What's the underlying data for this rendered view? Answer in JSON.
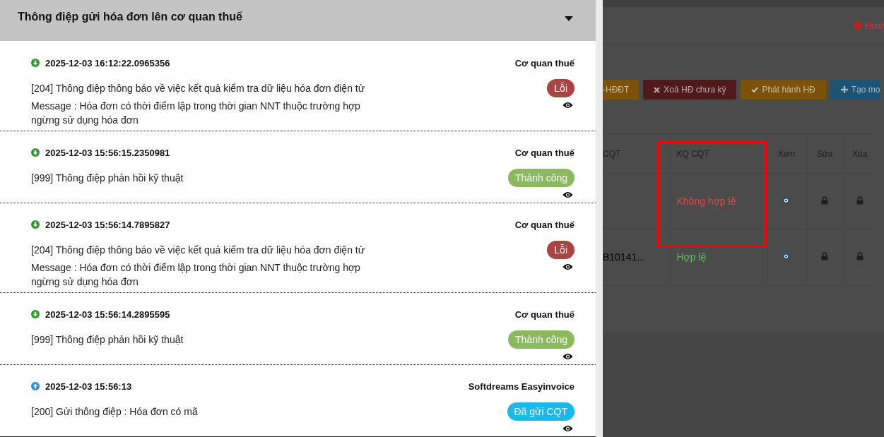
{
  "panel": {
    "title": "Thông điệp gửi hóa đơn lên cơ quan thuế",
    "expanded": true,
    "messages": [
      {
        "kind": "received",
        "time": "2025-12-03 16:12:22.0965356",
        "source": "Cơ quan thuế",
        "text": "[204] Thông điệp thông báo về việc kết quả kiểm tra dữ liệu hóa đơn điện tử",
        "message": "Message : Hóa đơn có thời điểm lập trong thời gian NNT thuộc trường hợp ngừng sử dụng hóa đơn",
        "status": {
          "label": "Lỗi",
          "kind": "error"
        }
      },
      {
        "kind": "received",
        "time": "2025-12-03 15:56:15.2350981",
        "source": "Cơ quan thuế",
        "text": "[999] Thông điệp phản hồi kỹ thuật",
        "status": {
          "label": "Thành công",
          "kind": "success"
        }
      },
      {
        "kind": "received",
        "time": "2025-12-03 15:56:14.7895827",
        "source": "Cơ quan thuế",
        "text": "[204] Thông điệp thông báo về việc kết quả kiểm tra dữ liệu hóa đơn điện tử",
        "message": "Message : Hóa đơn có thời điểm lập trong thời gian NNT thuộc trường hợp ngừng sử dụng hóa đơn",
        "status": {
          "label": "Lỗi",
          "kind": "error"
        }
      },
      {
        "kind": "received",
        "time": "2025-12-03 15:56:14.2895595",
        "source": "Cơ quan thuế",
        "text": "[999] Thông điệp phản hồi kỹ thuật",
        "status": {
          "label": "Thành công",
          "kind": "success"
        }
      },
      {
        "kind": "sent",
        "time": "2025-12-03 15:56:13",
        "source": "Softdreams Easyinvoice",
        "text": "[200] Gửi thông điệp : Hóa đơn có mã",
        "status": {
          "label": "Đã gửi CQT",
          "kind": "sent"
        }
      }
    ]
  },
  "background": {
    "help_link": "Hướ",
    "buttons": [
      {
        "label": "-HĐĐT",
        "kind": "warning"
      },
      {
        "label": "Xoá HĐ chưa ký",
        "kind": "delete"
      },
      {
        "label": "Phát hành HĐ",
        "kind": "publish"
      },
      {
        "label": "Tạo mo",
        "kind": "create"
      }
    ],
    "table": {
      "columns": [
        "CQT",
        "KQ CQT",
        "Xem",
        "Sửa",
        "Xóa"
      ],
      "rows": [
        {
          "result": "Không hợp lệ",
          "valid": false,
          "highlighted": true
        },
        {
          "column_1": "B10141...",
          "result": "Hợp lệ",
          "valid": true,
          "highlighted": false
        }
      ]
    }
  }
}
